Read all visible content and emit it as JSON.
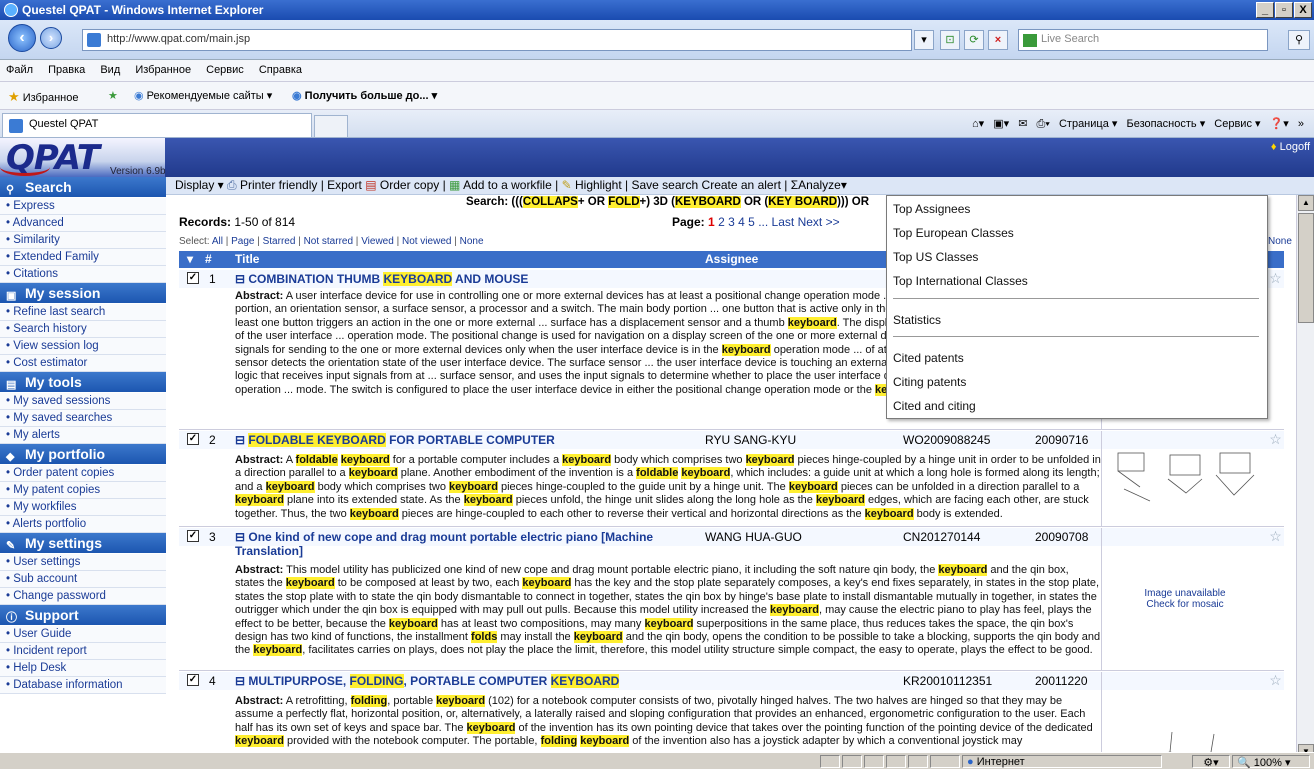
{
  "window": {
    "title": "Questel QPAT - Windows Internet Explorer",
    "min": "_",
    "max": "▫",
    "close": "X"
  },
  "address": {
    "url": "http://www.qpat.com/main.jsp",
    "search_placeholder": "Live Search"
  },
  "menu": [
    "Файл",
    "Правка",
    "Вид",
    "Избранное",
    "Сервис",
    "Справка"
  ],
  "favorites": {
    "favorites": "Избранное",
    "recommended": "Рекомендуемые сайты ▾",
    "more": "Получить больше до... ▾"
  },
  "tab": {
    "title": "Questel QPAT"
  },
  "commands": {
    "page": "Страница ▾",
    "security": "Безопасность ▾",
    "service": "Сервис ▾",
    "chevron": "»"
  },
  "app": {
    "logo": "QPAT",
    "version": "Version 6.9b",
    "logoff": "Logoff"
  },
  "toolbar": {
    "display": "Display ▾",
    "printer": "Printer friendly",
    "export": "Export",
    "order": "Order copy",
    "workfile": "Add to a workfile",
    "highlight": "Highlight",
    "save": "Save search",
    "alert": "Create an alert",
    "analyze": "Analyze▾"
  },
  "sidebar": [
    {
      "title": "Search",
      "items": [
        "Express",
        "Advanced",
        "Similarity",
        "Extended Family",
        "Citations"
      ]
    },
    {
      "title": "My session",
      "items": [
        "Refine last search",
        "Search history",
        "View session log",
        "Cost estimator"
      ]
    },
    {
      "title": "My tools",
      "items": [
        "My saved sessions",
        "My saved searches",
        "My alerts"
      ]
    },
    {
      "title": "My portfolio",
      "items": [
        "Order patent copies",
        "My patent copies",
        "My workfiles",
        "Alerts portfolio"
      ]
    },
    {
      "title": "My settings",
      "items": [
        "User settings",
        "Sub account",
        "Change password"
      ]
    },
    {
      "title": "Support",
      "items": [
        "User Guide",
        "Incident report",
        "Help Desk",
        "Database information"
      ]
    }
  ],
  "results": {
    "search_label": "Search:",
    "search_parts": [
      "(((",
      "COLLAPS",
      "+ OR ",
      "FOLD",
      "+) 3D (",
      "KEYBOARD",
      " OR (",
      "KEY BOARD",
      "))) OR"
    ],
    "records_label": "Records:",
    "records": "1-50 of 814",
    "page_label": "Page:",
    "pages": [
      "1",
      "2",
      "3",
      "4",
      "5",
      "... Last",
      "Next",
      ">>"
    ],
    "select_label": "Select:",
    "select_options": [
      "All",
      "Page",
      "Starred",
      "Not starred",
      "Viewed",
      "Not viewed",
      "None"
    ],
    "select_none_right": "None",
    "headers": {
      "num": "#",
      "title": "Title",
      "assignee": "Assignee"
    },
    "abstract_label": "Abstract:",
    "rows": [
      {
        "num": "1",
        "title_parts": [
          "COMBINATION THUMB ",
          "KEYBOARD",
          " AND MOUSE"
        ],
        "assignee": "",
        "pnum": "",
        "date": "",
        "abstract": "A user interface device for use in controlling one or more external devices has at least a positional change operation mode ... user interface device has a main body portion, an orientation sensor, a surface sensor, a processor and a switch. The main body portion ... one button that is active only in the positional change operation mode. The at least one button triggers an action in the one or more external ... surface has a displacement sensor and a thumb keyboard. The displacement sensor detects positional change of the user interface ... operation mode. The positional change is used for navigation on a display screen of the one or more external devices. The thumb keyboard ... keyboard signals for sending to the one or more external devices only when the user interface device is in the keyboard operation mode ... of at least alphabetic characters. The orientation sensor detects the orientation state of the user interface device. The surface sensor ... the user interface device is touching an external surface. The processor includes processor logic that receives input signals from at ... surface sensor, and uses the input signals to determine whether to place the user interface device in either the positional change operation ... mode. The switch is configured to place the user interface device in either the positional change operation mode or the keyboard operation mode.",
        "image": ""
      },
      {
        "num": "2",
        "title_parts": [
          "FOLDABLE ",
          "KEYBOARD",
          " FOR PORTABLE COMPUTER"
        ],
        "assignee": "RYU SANG-KYU",
        "pnum": "WO2009088245",
        "date": "20090716",
        "abstract": "A foldable keyboard for a portable computer includes a keyboard body which comprises two keyboard pieces hinge-coupled by a hinge unit in order to be unfolded in a direction parallel to a keyboard plane. Another embodiment of the invention is a foldable keyboard, which includes: a guide unit at which a long hole is formed along its length; and a keyboard body which comprises two keyboard pieces hinge-coupled to the guide unit by a hinge unit. The keyboard pieces can be unfolded in a direction parallel to a keyboard plane into its extended state. As the keyboard pieces unfold, the hinge unit slides along the long hole as the keyboard edges, which are facing each other, are stuck together. Thus, the two keyboard pieces are hinge-coupled to each other to reverse their vertical and horizontal directions as the keyboard body is extended.",
        "image": "drawing"
      },
      {
        "num": "3",
        "title_parts": [
          "One kind of new cope and drag mount portable electric piano [Machine Translation]"
        ],
        "assignee": "WANG HUA-GUO",
        "pnum": "CN201270144",
        "date": "20090708",
        "abstract": "This model utility has publicized one kind of new cope and drag mount portable electric piano, it including the soft nature qin body, the keyboard and the qin box, states the keyboard to be composed at least by two, each keyboard has the key and the stop plate separately composes, a key's end fixes separately, in states in the stop plate, states the stop plate with to state the qin body dismantable to connect in together, states the qin box by hinge's base plate to install dismantable mutually in together, in states the outrigger which under the qin box is equipped with may pull out pulls. Because this model utility increased the keyboard, may cause the electric piano to play has feel, plays the effect to be better, because the keyboard has at least two compositions, may many keyboard superpositions in the same place, thus reduces takes the space, the qin box's design has two kind of functions, the installment folds may install the keyboard and the qin body, opens the condition to be possible to take a blocking, supports the qin body and the keyboard, facilitates carries on plays, does not play the place the limit, therefore, this model utility structure simple compact, the easy to operate, plays the effect to be good.",
        "image_unavailable": "Image unavailable",
        "image_mosaic": "Check for mosaic"
      },
      {
        "num": "4",
        "title_parts": [
          "MULTIPURPOSE, ",
          "FOLDING",
          ", PORTABLE COMPUTER ",
          "KEYBOARD"
        ],
        "assignee": "",
        "pnum": "KR20010112351",
        "date": "20011220",
        "abstract": "A retrofitting, folding, portable keyboard (102) for a notebook computer consists of two, pivotally hinged halves. The two halves are hinged so that they may be assume a perfectly flat, horizontal position, or, alternatively, a laterally raised and sloping configuration that provides an enhanced, ergonometric configuration to the user. Each half has its own set of keys and space bar. The keyboard of the invention has its own pointing device that takes over the pointing function of the pointing device of the dedicated keyboard provided with the notebook computer. The portable, folding keyboard of the invention also has a joystick adapter by which a conventional joystick may",
        "image": "drawing"
      }
    ]
  },
  "analyze_menu": {
    "items": [
      "Top Assignees",
      "Top European Classes",
      "Top US Classes",
      "Top International Classes",
      "Statistics",
      "Cited patents",
      "Citing patents",
      "Cited and citing"
    ]
  },
  "status": {
    "zone": "Интернет",
    "zoom": "100%"
  }
}
